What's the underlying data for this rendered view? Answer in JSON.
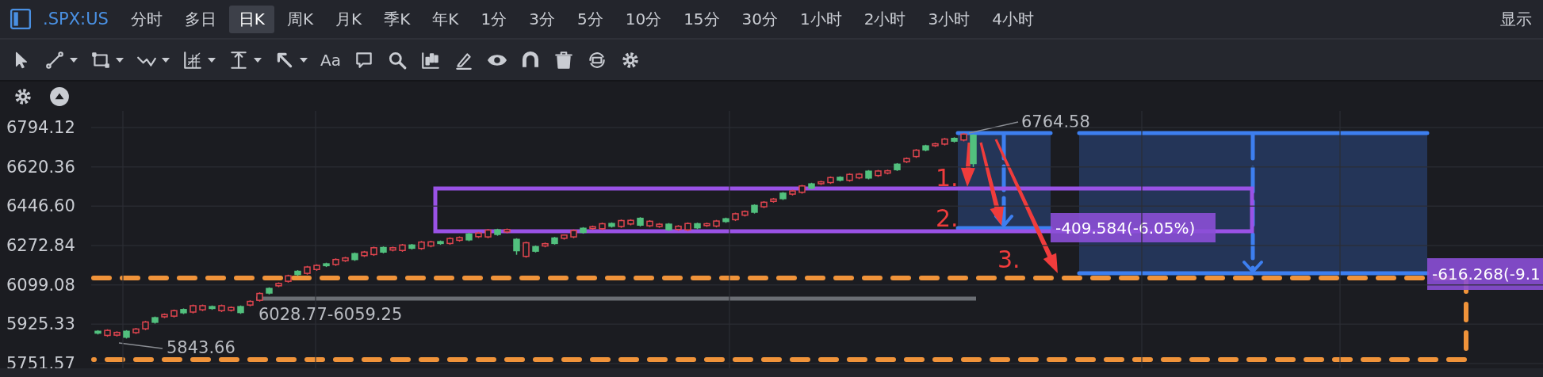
{
  "header": {
    "ticker": ".SPX:US",
    "tabs": [
      {
        "label": "分时",
        "selected": false
      },
      {
        "label": "多日",
        "selected": false
      },
      {
        "label": "日K",
        "selected": true
      },
      {
        "label": "周K",
        "selected": false
      },
      {
        "label": "月K",
        "selected": false
      },
      {
        "label": "季K",
        "selected": false
      },
      {
        "label": "年K",
        "selected": false
      },
      {
        "label": "1分",
        "selected": false
      },
      {
        "label": "3分",
        "selected": false
      },
      {
        "label": "5分",
        "selected": false
      },
      {
        "label": "10分",
        "selected": false
      },
      {
        "label": "15分",
        "selected": false
      },
      {
        "label": "30分",
        "selected": false
      },
      {
        "label": "1小时",
        "selected": false
      },
      {
        "label": "2小时",
        "selected": false
      },
      {
        "label": "3小时",
        "selected": false
      },
      {
        "label": "4小时",
        "selected": false
      }
    ],
    "display": "显示"
  },
  "toolbar": [
    {
      "kind": "cursor",
      "has_menu": false
    },
    {
      "kind": "line",
      "has_menu": true
    },
    {
      "kind": "rect",
      "has_menu": true
    },
    {
      "kind": "wave",
      "has_menu": true
    },
    {
      "kind": "grid",
      "has_menu": true
    },
    {
      "kind": "measure",
      "has_menu": true
    },
    {
      "kind": "arrow",
      "has_menu": true
    },
    {
      "kind": "text",
      "label": "Aa",
      "has_menu": false
    },
    {
      "kind": "comment",
      "has_menu": false
    },
    {
      "kind": "search",
      "has_menu": false
    },
    {
      "kind": "candles",
      "has_menu": false
    },
    {
      "kind": "pencil",
      "has_menu": false
    },
    {
      "kind": "eye",
      "has_menu": false
    },
    {
      "kind": "magnet",
      "has_menu": false
    },
    {
      "kind": "trash",
      "has_menu": false
    },
    {
      "kind": "sync",
      "has_menu": false
    },
    {
      "kind": "gear",
      "has_menu": false
    }
  ],
  "chart": {
    "high_label": "6764.58",
    "range_label": "6028.77-6059.25",
    "low_label": "5843.66",
    "measure_labels": [
      "-409.584(-6.05%)",
      "-616.268(-9.1"
    ],
    "step_numbers": [
      "1.",
      "2.",
      "3."
    ],
    "chart_data": {
      "type": "candlestick",
      "grid": true,
      "ylim": [
        5751.57,
        6794.12
      ],
      "yticks": [
        {
          "value": 6794.12,
          "label": "6794.12"
        },
        {
          "value": 6620.36,
          "label": "6620.36"
        },
        {
          "value": 6446.6,
          "label": "6446.60"
        },
        {
          "value": 6272.84,
          "label": "6272.84"
        },
        {
          "value": 6099.08,
          "label": "6099.08"
        },
        {
          "value": 5925.33,
          "label": "5925.33"
        },
        {
          "value": 5751.57,
          "label": "5751.57"
        }
      ],
      "ohlc": [
        [
          5894,
          5899,
          5880,
          5886
        ],
        [
          5876,
          5903,
          5870,
          5898
        ],
        [
          5877,
          5894,
          5871,
          5889
        ],
        [
          5894,
          5899,
          5862,
          5868
        ],
        [
          5888,
          5909,
          5882,
          5904
        ],
        [
          5905,
          5940,
          5899,
          5935
        ],
        [
          5954,
          5959,
          5928,
          5934
        ],
        [
          5958,
          5973,
          5952,
          5968
        ],
        [
          5961,
          5990,
          5955,
          5985
        ],
        [
          5990,
          5995,
          5970,
          5976
        ],
        [
          5979,
          6012,
          5973,
          6007
        ],
        [
          5989,
          6012,
          5983,
          6007
        ],
        [
          6003,
          6008,
          5989,
          5995
        ],
        [
          5985,
          6012,
          5979,
          6007
        ],
        [
          5987,
          6004,
          5981,
          5999
        ],
        [
          6003,
          6008,
          5971,
          5977
        ],
        [
          6010,
          6031,
          6004,
          6026
        ],
        [
          6031,
          6066,
          6025,
          6061
        ],
        [
          6083,
          6088,
          6057,
          6063
        ],
        [
          6095,
          6110,
          6089,
          6105
        ],
        [
          6115,
          6144,
          6109,
          6139
        ],
        [
          6159,
          6164,
          6139,
          6145
        ],
        [
          6150,
          6183,
          6144,
          6178
        ],
        [
          6167,
          6190,
          6161,
          6185
        ],
        [
          6192,
          6197,
          6178,
          6184
        ],
        [
          6189,
          6216,
          6183,
          6211
        ],
        [
          6206,
          6223,
          6200,
          6218
        ],
        [
          6237,
          6242,
          6205,
          6211
        ],
        [
          6228,
          6249,
          6222,
          6244
        ],
        [
          6233,
          6268,
          6227,
          6263
        ],
        [
          6264,
          6269,
          6238,
          6244
        ],
        [
          6253,
          6268,
          6247,
          6263
        ],
        [
          6251,
          6280,
          6245,
          6275
        ],
        [
          6275,
          6280,
          6255,
          6261
        ],
        [
          6260,
          6293,
          6254,
          6288
        ],
        [
          6271,
          6294,
          6265,
          6289
        ],
        [
          6290,
          6295,
          6276,
          6282
        ],
        [
          6282,
          6309,
          6276,
          6304
        ],
        [
          6296,
          6313,
          6290,
          6308
        ],
        [
          6324,
          6329,
          6292,
          6298
        ],
        [
          6312,
          6333,
          6306,
          6328
        ],
        [
          6311,
          6346,
          6305,
          6341
        ],
        [
          6342,
          6347,
          6316,
          6322
        ],
        [
          6333,
          6348,
          6327,
          6343
        ],
        [
          6300,
          6305,
          6232,
          6250
        ],
        [
          6225,
          6290,
          6219,
          6285
        ],
        [
          6268,
          6273,
          6242,
          6248
        ],
        [
          6271,
          6286,
          6265,
          6281
        ],
        [
          6306,
          6311,
          6277,
          6282
        ],
        [
          6305,
          6322,
          6299,
          6319
        ],
        [
          6311,
          6344,
          6305,
          6339
        ],
        [
          6349,
          6354,
          6325,
          6331
        ],
        [
          6348,
          6361,
          6342,
          6356
        ],
        [
          6347,
          6374,
          6341,
          6369
        ],
        [
          6370,
          6375,
          6352,
          6358
        ],
        [
          6357,
          6388,
          6351,
          6383
        ],
        [
          6368,
          6389,
          6362,
          6384
        ],
        [
          6393,
          6398,
          6357,
          6363
        ],
        [
          6360,
          6385,
          6354,
          6380
        ],
        [
          6357,
          6372,
          6351,
          6367
        ],
        [
          6367,
          6372,
          6337,
          6343
        ],
        [
          6344,
          6363,
          6338,
          6358
        ],
        [
          6342,
          6375,
          6336,
          6370
        ],
        [
          6369,
          6374,
          6345,
          6351
        ],
        [
          6361,
          6374,
          6355,
          6369
        ],
        [
          6359,
          6386,
          6353,
          6381
        ],
        [
          6391,
          6396,
          6373,
          6379
        ],
        [
          6387,
          6418,
          6381,
          6413
        ],
        [
          6407,
          6428,
          6401,
          6423
        ],
        [
          6450,
          6455,
          6414,
          6420
        ],
        [
          6444,
          6469,
          6438,
          6464
        ],
        [
          6468,
          6483,
          6462,
          6478
        ],
        [
          6504,
          6509,
          6474,
          6480
        ],
        [
          6500,
          6519,
          6494,
          6514
        ],
        [
          6508,
          6541,
          6502,
          6536
        ],
        [
          6545,
          6550,
          6521,
          6527
        ],
        [
          6546,
          6559,
          6540,
          6554
        ],
        [
          6551,
          6578,
          6545,
          6573
        ],
        [
          6574,
          6579,
          6556,
          6562
        ],
        [
          6561,
          6592,
          6555,
          6587
        ],
        [
          6572,
          6593,
          6566,
          6588
        ],
        [
          6601,
          6606,
          6565,
          6571
        ],
        [
          6582,
          6607,
          6576,
          6602
        ],
        [
          6593,
          6608,
          6587,
          6603
        ],
        [
          6632,
          6637,
          6602,
          6608
        ],
        [
          6643,
          6662,
          6637,
          6657
        ],
        [
          6666,
          6699,
          6660,
          6694
        ],
        [
          6713,
          6718,
          6689,
          6695
        ],
        [
          6714,
          6727,
          6708,
          6722
        ],
        [
          6721,
          6748,
          6715,
          6743
        ],
        [
          6746,
          6751,
          6728,
          6734
        ],
        [
          6739,
          6770,
          6733,
          6765
        ],
        [
          6760,
          6764,
          6620,
          6635
        ]
      ]
    }
  }
}
